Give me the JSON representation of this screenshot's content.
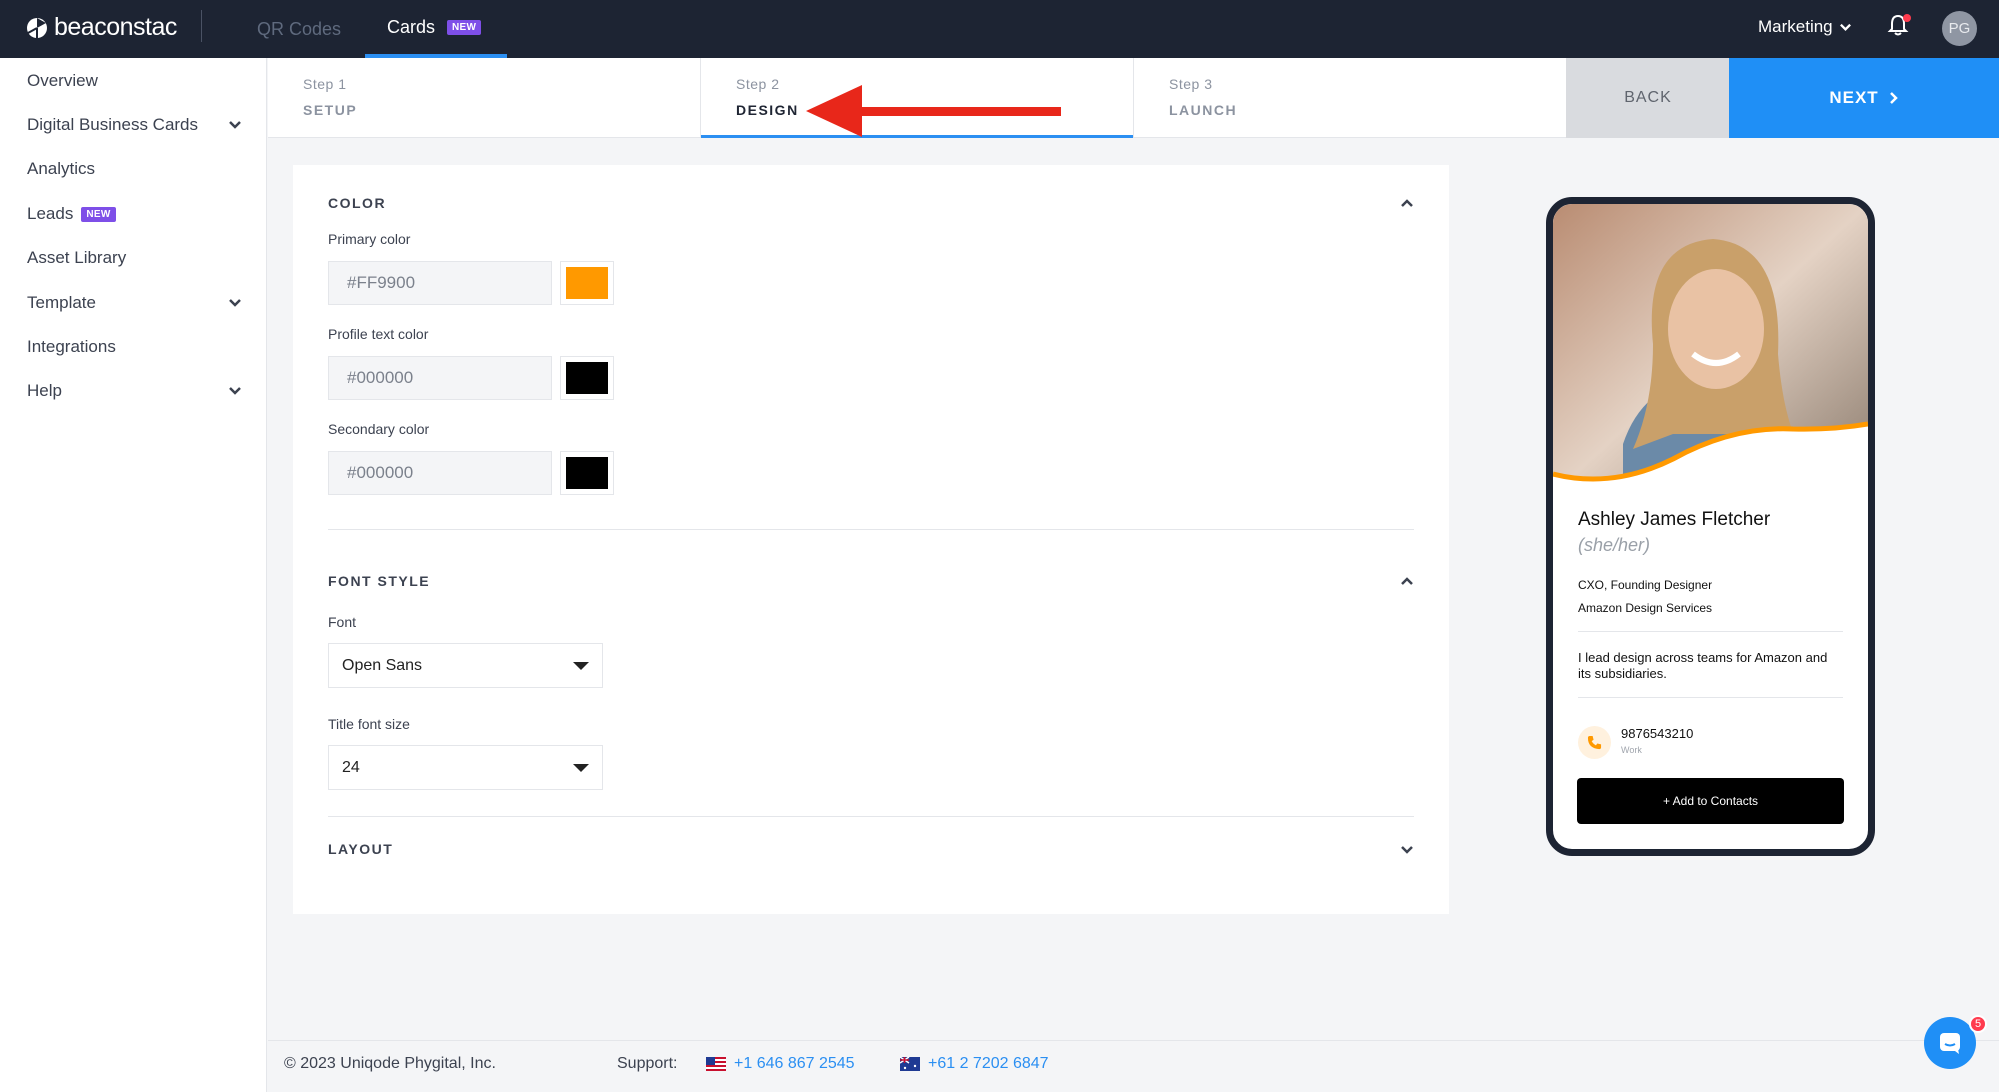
{
  "brand": {
    "name": "beaconstac"
  },
  "topnav": {
    "tabs": [
      {
        "label": "QR Codes",
        "active": false
      },
      {
        "label": "Cards",
        "active": true,
        "badge": "NEW"
      }
    ],
    "workspace": "Marketing",
    "avatar_initials": "PG",
    "icons": [
      "bell-icon",
      "chevron-down-icon"
    ]
  },
  "sidebar": {
    "items": [
      {
        "label": "Overview"
      },
      {
        "label": "Digital Business Cards",
        "expandable": true
      },
      {
        "label": "Analytics"
      },
      {
        "label": "Leads",
        "badge": "NEW"
      },
      {
        "label": "Asset Library"
      },
      {
        "label": "Template",
        "expandable": true
      },
      {
        "label": "Integrations"
      },
      {
        "label": "Help",
        "expandable": true
      }
    ]
  },
  "stepper": {
    "steps": [
      {
        "num": "Step 1",
        "name": "SETUP"
      },
      {
        "num": "Step 2",
        "name": "DESIGN",
        "active": true
      },
      {
        "num": "Step 3",
        "name": "LAUNCH"
      }
    ],
    "back_label": "BACK",
    "next_label": "NEXT"
  },
  "design": {
    "color_section": {
      "title": "COLOR",
      "primary": {
        "label": "Primary color",
        "value": "#FF9900"
      },
      "profile_text": {
        "label": "Profile text color",
        "value": "#000000"
      },
      "secondary": {
        "label": "Secondary color",
        "value": "#000000"
      }
    },
    "font_section": {
      "title": "FONT STYLE",
      "font": {
        "label": "Font",
        "value": "Open Sans"
      },
      "title_size": {
        "label": "Title font size",
        "value": "24"
      }
    },
    "layout_section": {
      "title": "LAYOUT"
    }
  },
  "preview": {
    "name": "Ashley James Fletcher",
    "pronouns": "(she/her)",
    "title": "CXO, Founding Designer",
    "company": "Amazon Design Services",
    "bio": "I lead design across teams for Amazon and its subsidiaries.",
    "phone": "9876543210",
    "phone_type": "Work",
    "add_contact_label": "+ Add to Contacts",
    "accent": "#FF9900"
  },
  "footer": {
    "copyright": "© 2023 Uniqode Phygital, Inc.",
    "support_label": "Support:",
    "phones": [
      {
        "flag": "us-flag-icon",
        "number": "+1 646 867 2545"
      },
      {
        "flag": "au-flag-icon",
        "number": "+61 2 7202 6847"
      }
    ]
  },
  "chat": {
    "unread": "5"
  },
  "colors": {
    "topbar": "#1d2433",
    "accent_blue": "#1f8ff6",
    "badge_purple": "#7e4fe8",
    "annotation_red": "#e8271a"
  }
}
